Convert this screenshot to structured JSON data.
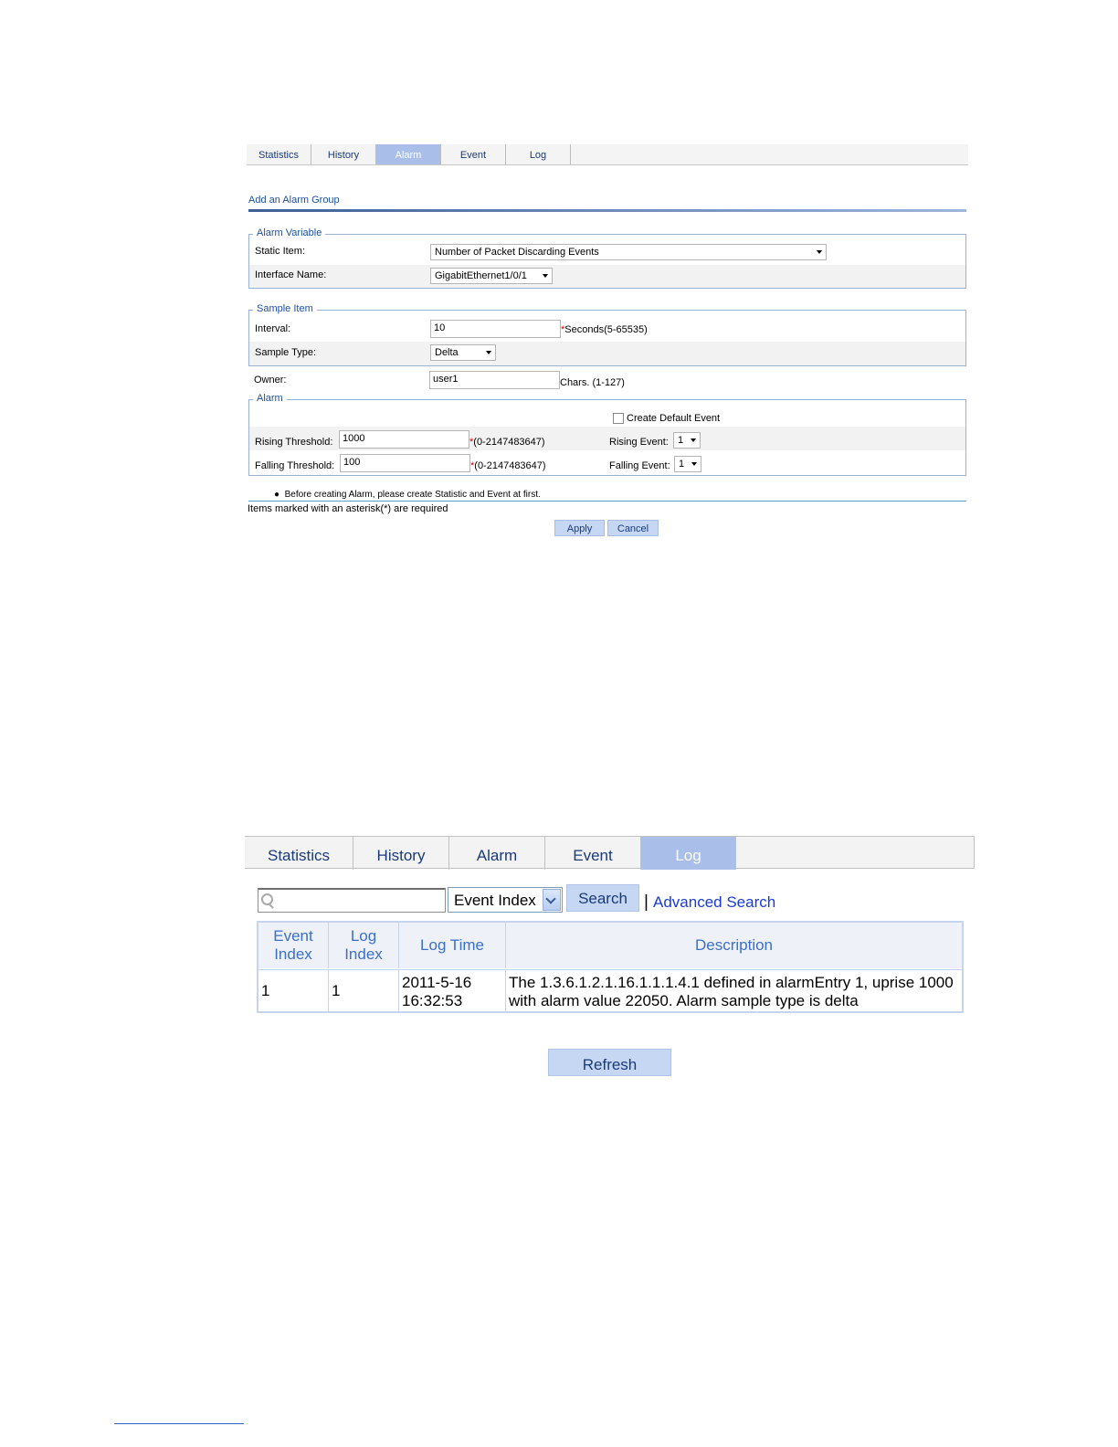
{
  "alarm_page": {
    "tabs": [
      "Statistics",
      "History",
      "Alarm",
      "Event",
      "Log"
    ],
    "active_tab": "Alarm",
    "section_title": "Add an Alarm Group",
    "alarm_variable": {
      "legend": "Alarm Variable",
      "static_item_label": "Static Item:",
      "static_item_value": "Number of Packet Discarding Events",
      "interface_name_label": "Interface Name:",
      "interface_name_value": "GigabitEthernet1/0/1"
    },
    "sample_item": {
      "legend": "Sample Item",
      "interval_label": "Interval:",
      "interval_value": "10",
      "interval_hint": "Seconds(5-65535)",
      "sample_type_label": "Sample Type:",
      "sample_type_value": "Delta"
    },
    "owner": {
      "label": "Owner:",
      "value": "user1",
      "hint": "Chars. (1-127)"
    },
    "alarm": {
      "legend": "Alarm",
      "create_default_event_label": "Create Default Event",
      "create_default_event_checked": false,
      "rising_threshold_label": "Rising Threshold:",
      "rising_threshold_value": "1000",
      "rising_threshold_hint": "(0-2147483647)",
      "falling_threshold_label": "Falling Threshold:",
      "falling_threshold_value": "100",
      "falling_threshold_hint": "(0-2147483647)",
      "rising_event_label": "Rising Event:",
      "rising_event_value": "1",
      "falling_event_label": "Falling Event:",
      "falling_event_value": "1"
    },
    "asterisk": "*",
    "note_bullet": "Before creating Alarm, please create Statistic and Event at first.",
    "required_note": "Items marked with an asterisk(*) are required",
    "apply_label": "Apply",
    "cancel_label": "Cancel"
  },
  "log_page": {
    "tabs": [
      "Statistics",
      "History",
      "Alarm",
      "Event",
      "Log"
    ],
    "active_tab": "Log",
    "search_value": "",
    "search_field_option": "Event Index",
    "search_button": "Search",
    "separator": "|",
    "advanced_search": "Advanced Search",
    "table": {
      "headers": [
        [
          "Event",
          "Index"
        ],
        [
          "Log",
          "Index"
        ],
        [
          "Log Time"
        ],
        [
          "Description"
        ]
      ],
      "rows": [
        {
          "event_index": "1",
          "log_index": "1",
          "log_time": [
            "2011-5-16",
            "16:32:53"
          ],
          "description": [
            "The 1.3.6.1.2.1.16.1.1.1.4.1 defined in alarmEntry 1, uprise 1000",
            "with alarm value 22050. Alarm sample type is delta"
          ]
        }
      ]
    },
    "refresh_button": "Refresh"
  },
  "icons": {
    "search": "search-icon",
    "dropdown": "chevron-down-icon",
    "checkbox": "checkbox-icon"
  },
  "colors": {
    "tab_active_bg": "#a9bfe9",
    "link_blue": "#1e4f9c",
    "required_red": "#e00000",
    "button_bg": "#c5d7f3"
  }
}
